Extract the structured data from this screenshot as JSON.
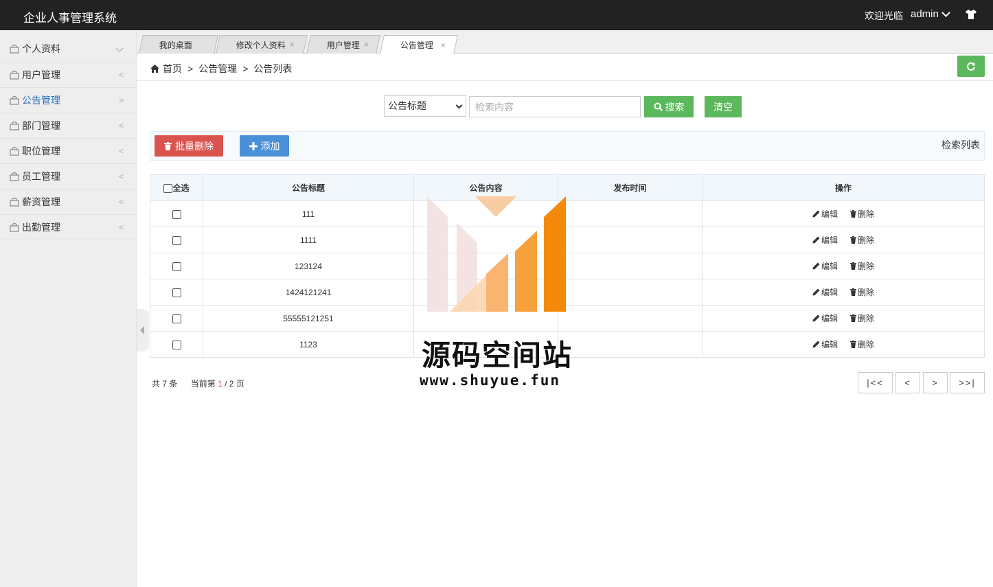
{
  "app": {
    "title": "企业人事管理系统",
    "welcome": "欢迎光临",
    "username": "admin"
  },
  "sidebar": {
    "items": [
      {
        "label": "个人资料",
        "arrow": ""
      },
      {
        "label": "用户管理",
        "arrow": "<"
      },
      {
        "label": "公告管理",
        "arrow": ">"
      },
      {
        "label": "部门管理",
        "arrow": "<"
      },
      {
        "label": "职位管理",
        "arrow": "<"
      },
      {
        "label": "员工管理",
        "arrow": "<"
      },
      {
        "label": "薪资管理",
        "arrow": "<"
      },
      {
        "label": "出勤管理",
        "arrow": "<"
      }
    ]
  },
  "tabs": [
    {
      "label": "我的桌面",
      "close": ""
    },
    {
      "label": "修改个人资料",
      "close": "×"
    },
    {
      "label": "用户管理",
      "close": "×"
    },
    {
      "label": "公告管理",
      "close": "×"
    }
  ],
  "breadcrumb": {
    "home": "首页",
    "sep": ">",
    "level1": "公告管理",
    "level2": "公告列表"
  },
  "search": {
    "field_selected": "公告标题",
    "placeholder": "检索内容",
    "search_label": "搜索",
    "clear_label": "清空"
  },
  "toolbar": {
    "batch_delete_label": "批量删除",
    "add_label": "添加",
    "list_label": "检索列表"
  },
  "table": {
    "select_all": "全选",
    "headers": [
      "公告标题",
      "公告内容",
      "发布时间",
      "操作"
    ],
    "edit_label": "编辑",
    "delete_label": "删除",
    "rows": [
      {
        "title": "111",
        "content": "",
        "time": ""
      },
      {
        "title": "1111",
        "content": "",
        "time": ""
      },
      {
        "title": "123124",
        "content": "",
        "time": ""
      },
      {
        "title": "1424121241",
        "content": "",
        "time": ""
      },
      {
        "title": "55555121251",
        "content": "",
        "time": ""
      },
      {
        "title": "1123",
        "content": "",
        "time": ""
      }
    ]
  },
  "pagination": {
    "total_prefix": "共",
    "total": "7",
    "total_suffix": "条",
    "current_prefix": "当前第",
    "current": "1",
    "pages": "/ 2",
    "pages_suffix": "页",
    "first": "|<<",
    "prev": "<",
    "next": ">",
    "last": ">>|"
  },
  "watermark": {
    "title": "源码空间站",
    "url": "www.shuyue.fun"
  },
  "colors": {
    "topbar": "#222222",
    "success": "#5cb85c",
    "danger": "#d9534f",
    "primary": "#4a90d9",
    "active_link": "#2a6ec0"
  }
}
